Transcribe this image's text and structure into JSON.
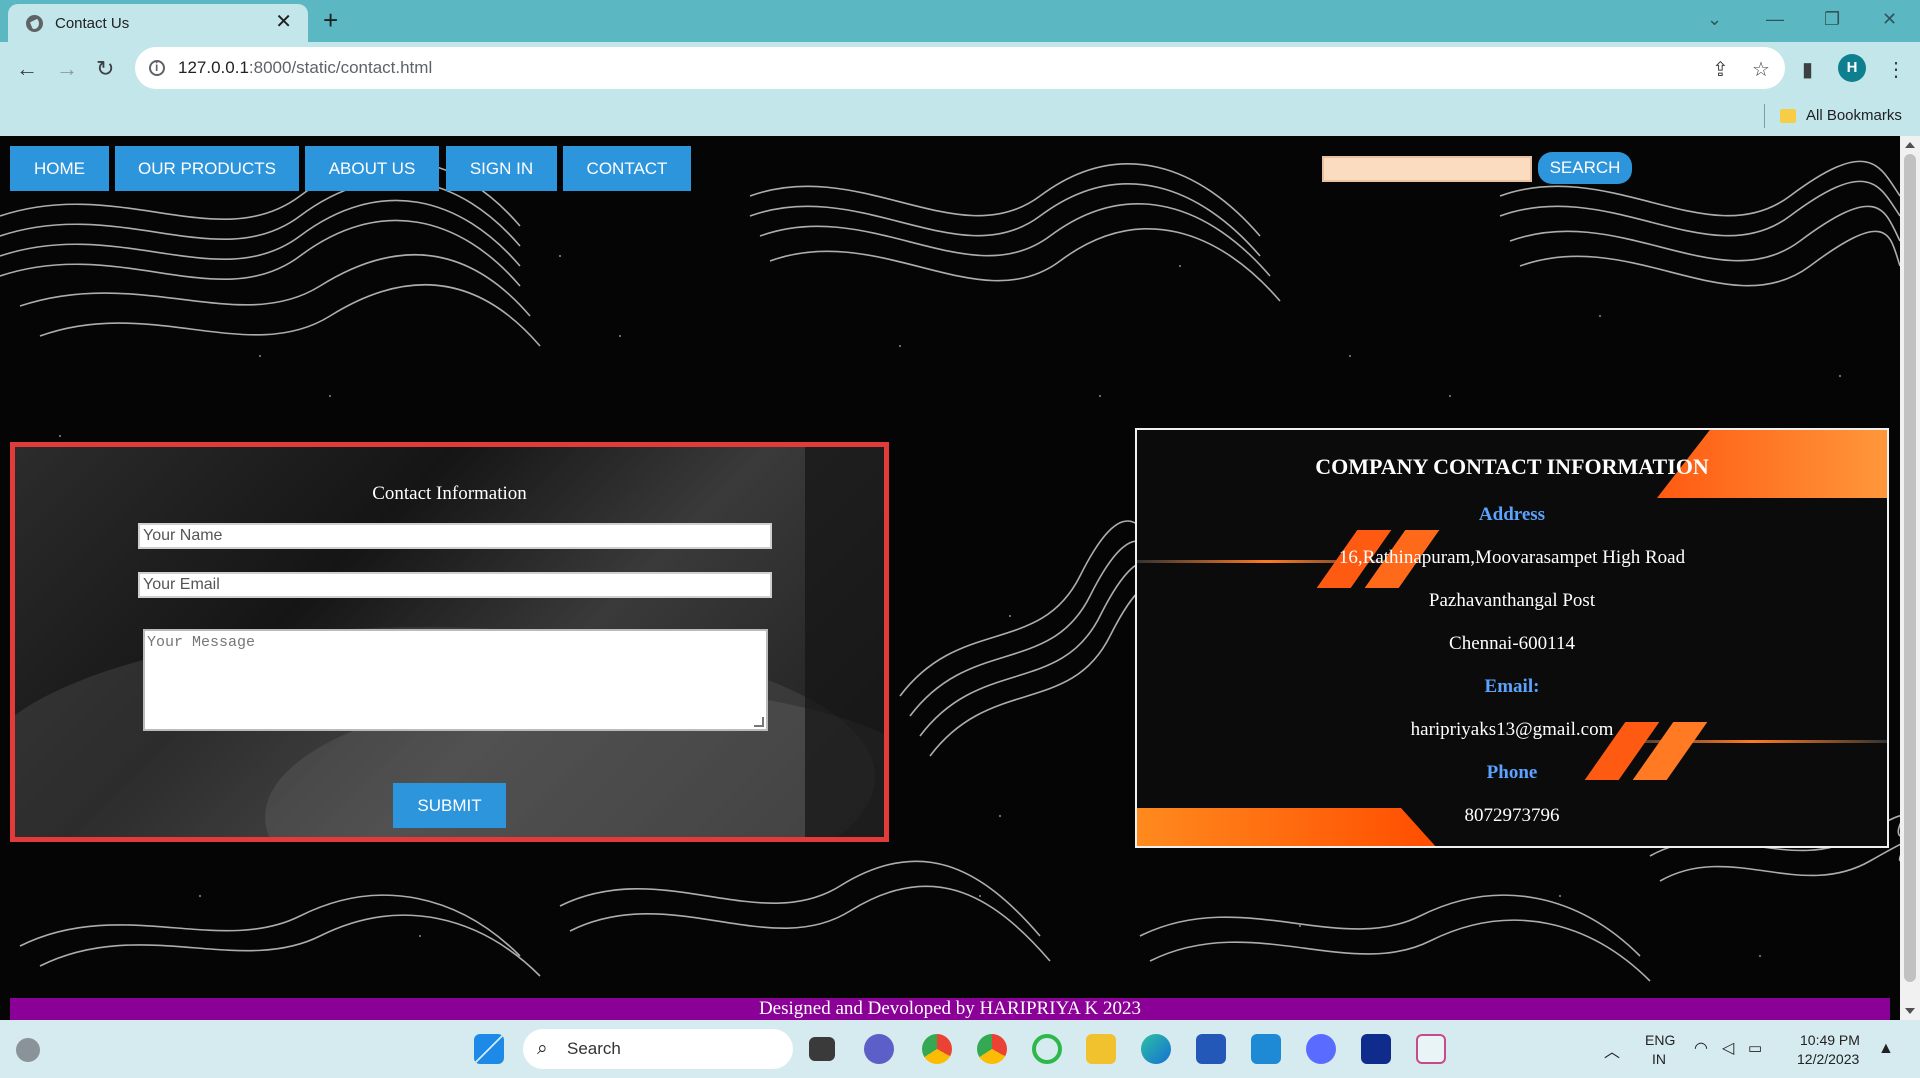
{
  "browser": {
    "tab_title": "Contact Us",
    "url_host": "127.0.0.1",
    "url_rest": ":8000/static/contact.html",
    "bookmarks_label": "All Bookmarks",
    "profile_initial": "H"
  },
  "nav": {
    "items": [
      "HOME",
      "OUR PRODUCTS",
      "ABOUT US",
      "SIGN IN",
      "CONTACT"
    ],
    "search_button": "SEARCH",
    "search_value": ""
  },
  "form": {
    "title": "Contact Information",
    "name_placeholder": "Your Name",
    "email_placeholder": "Your Email",
    "message_placeholder": "Your Message",
    "submit_label": "SUBMIT"
  },
  "company": {
    "title": "COMPANY CONTACT INFORMATION",
    "address_heading": "Address",
    "address_line1": "16,Rathinapuram,Moovarasampet High Road",
    "address_line2": "Pazhavanthangal Post",
    "address_line3": "Chennai-600114",
    "email_heading": "Email:",
    "email": "haripriyaks13@gmail.com",
    "phone_heading": "Phone",
    "phone": "8072973796"
  },
  "footer": {
    "text": "Designed and Devoloped by HARIPRIYA K 2023"
  },
  "taskbar": {
    "search_label": "Search",
    "lang_line1": "ENG",
    "lang_line2": "IN",
    "time": "10:49 PM",
    "date": "12/2/2023"
  },
  "colors": {
    "accent_blue": "#2d95dc",
    "form_border": "#e23b3b",
    "footer": "#8b0096",
    "info_heading": "#5aa3ff",
    "orange": "#ff5a12"
  }
}
